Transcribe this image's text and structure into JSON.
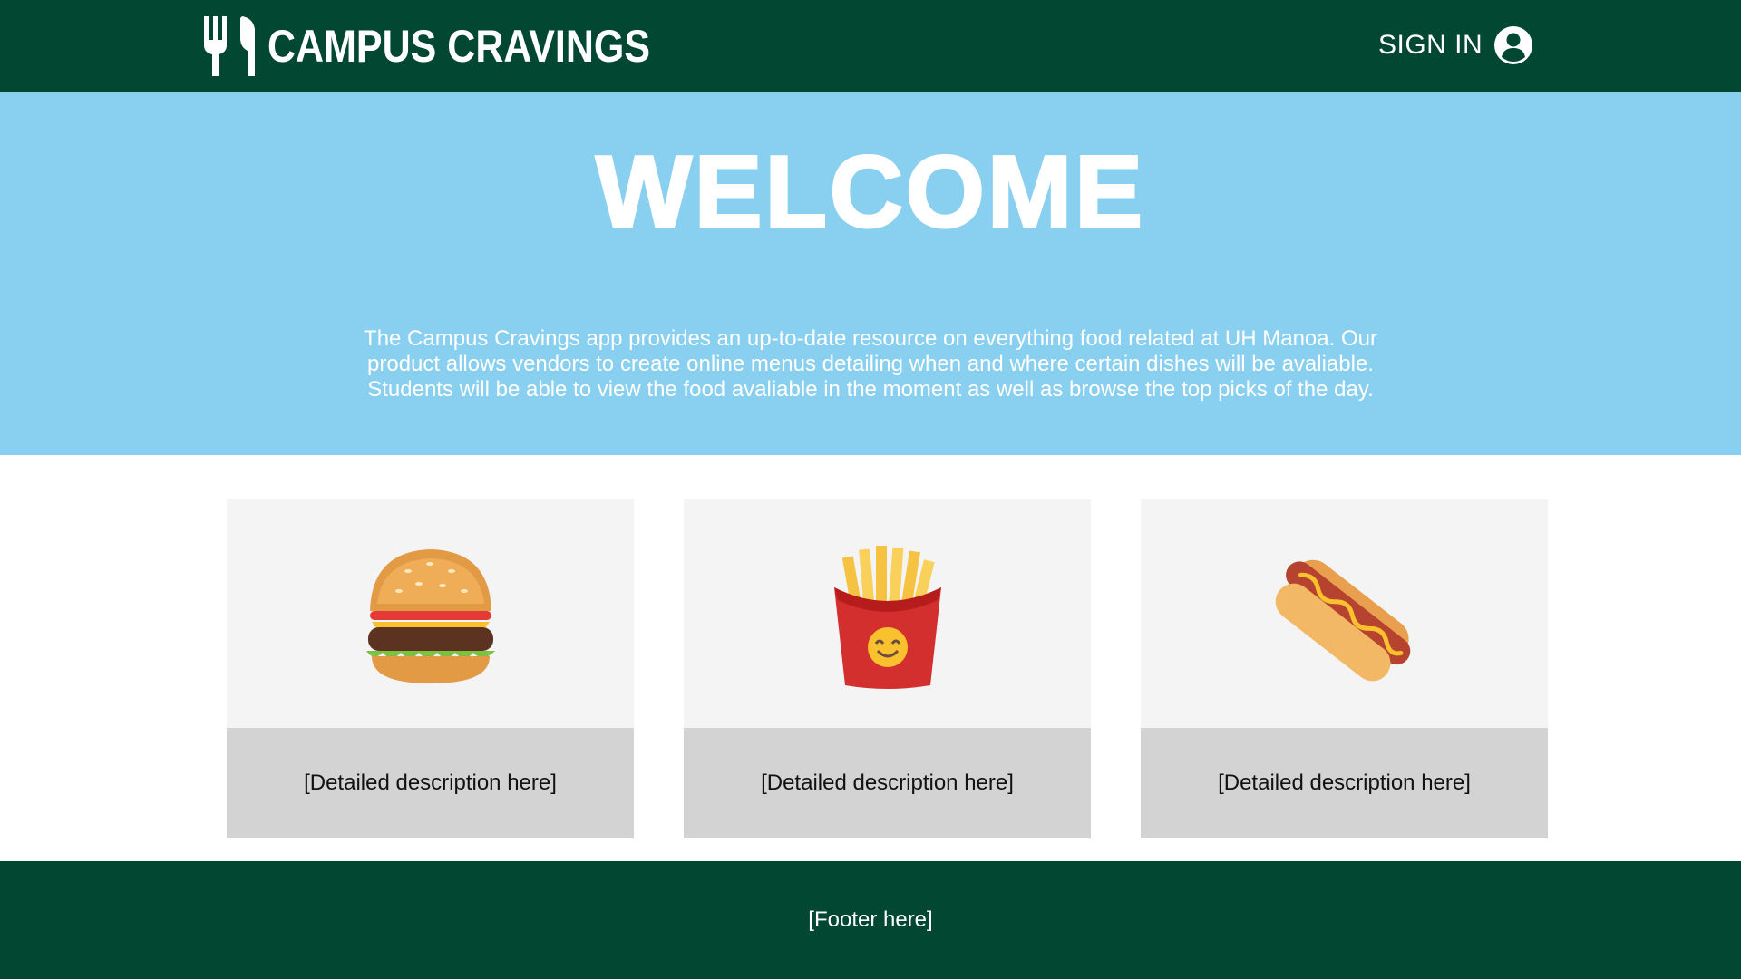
{
  "navbar": {
    "brand_name": "CAMPUS CRAVINGS",
    "brand_icon": "fork-knife-icon",
    "signin_label": "SIGN IN",
    "signin_icon": "user-circle-icon",
    "background_color": "#024731"
  },
  "hero": {
    "title": "WELCOME",
    "description": "The Campus Cravings app provides an up-to-date resource on everything food related at UH Manoa. Our product allows vendors to create online menus detailing when and where certain dishes will be avaliable. Students will be able to view the food avaliable in the moment as well as browse the top picks of the day.",
    "background_color": "#89cff0"
  },
  "cards": [
    {
      "icon": "hamburger-icon",
      "caption": "[Detailed description here]"
    },
    {
      "icon": "french-fries-icon",
      "caption": "[Detailed description here]"
    },
    {
      "icon": "hot-dog-icon",
      "caption": "[Detailed description here]"
    }
  ],
  "footer": {
    "text": "[Footer here]",
    "background_color": "#024731"
  }
}
